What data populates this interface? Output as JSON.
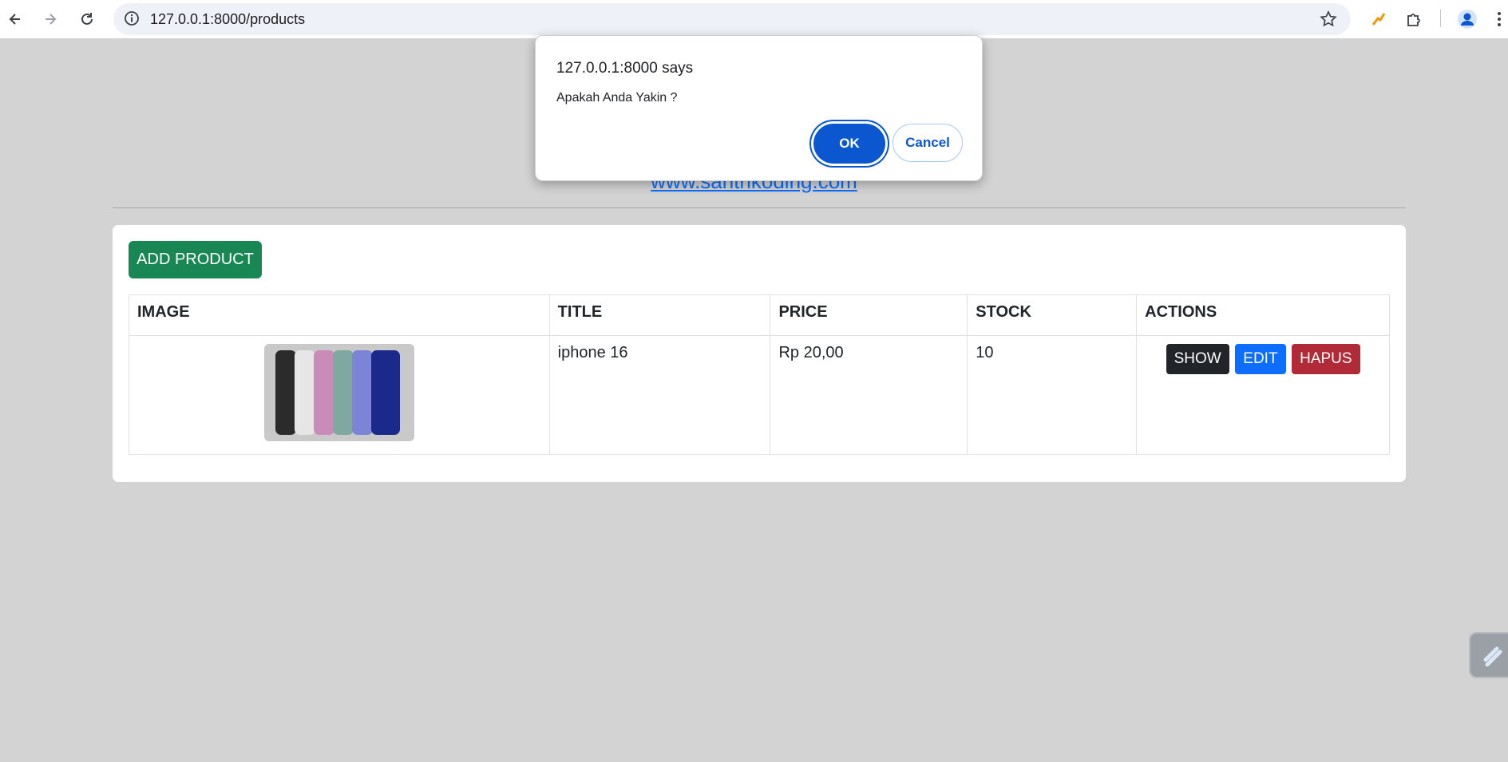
{
  "browser": {
    "url": "127.0.0.1:8000/products",
    "icons": [
      "back-icon",
      "forward-icon",
      "reload-icon",
      "site-info-icon",
      "bookmark-star-icon",
      "extension-bolt-icon",
      "extensions-puzzle-icon",
      "profile-icon",
      "menu-icon"
    ]
  },
  "page": {
    "link_text": "www.santrikoding.com",
    "add_button_label": "ADD PRODUCT",
    "table": {
      "headers": [
        "IMAGE",
        "TITLE",
        "PRICE",
        "STOCK",
        "ACTIONS"
      ],
      "rows": [
        {
          "title": "iphone 16",
          "price": "Rp 20,00",
          "stock": "10",
          "actions": [
            "SHOW",
            "EDIT",
            "HAPUS"
          ]
        }
      ]
    },
    "colors": {
      "show": "#212529",
      "edit": "#0d6efd",
      "hapus": "#b02a37",
      "add": "#198754"
    }
  },
  "dialog": {
    "title": "127.0.0.1:8000 says",
    "message": "Apakah Anda Yakin ?",
    "ok_label": "OK",
    "cancel_label": "Cancel"
  }
}
